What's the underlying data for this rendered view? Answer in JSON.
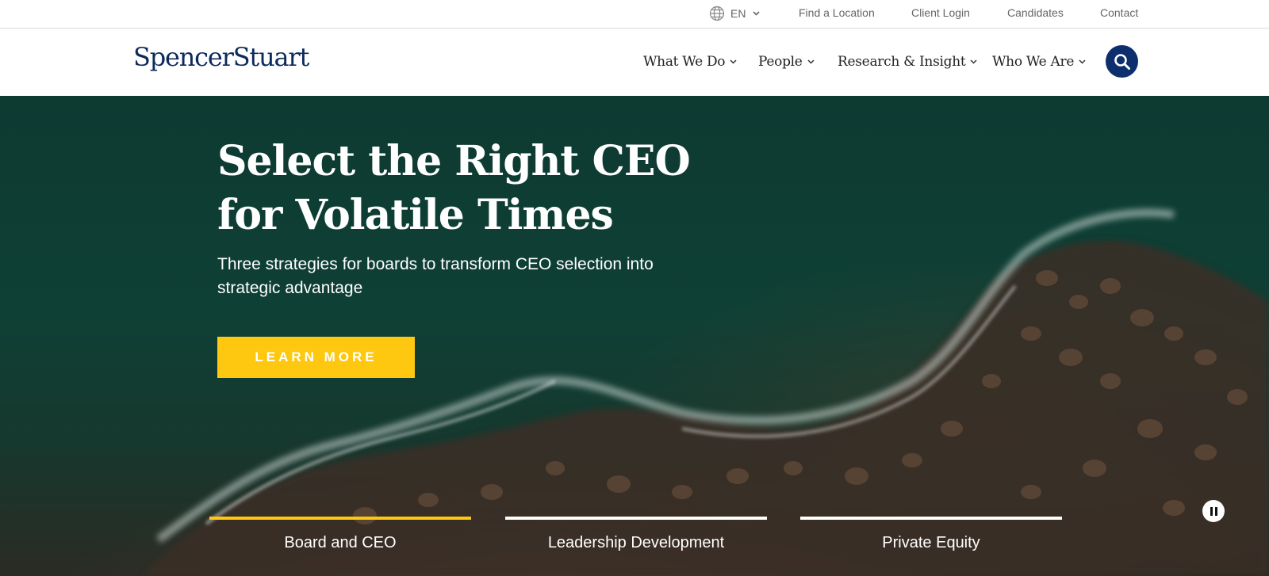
{
  "utility_bar": {
    "language": "EN",
    "links": [
      "Find a Location",
      "Client Login",
      "Candidates",
      "Contact"
    ]
  },
  "header": {
    "logo": "SpencerStuart",
    "nav": [
      "What We Do",
      "People",
      "Research & Insight",
      "Who We Are"
    ]
  },
  "hero": {
    "title": "Select the Right CEO for Volatile Times",
    "subtitle": "Three strategies for boards to transform CEO selection into strategic advantage",
    "cta": "LEARN MORE"
  },
  "tabs": [
    "Board and CEO",
    "Leadership Development",
    "Private Equity"
  ],
  "colors": {
    "brand_navy": "#0e2a5c",
    "accent_yellow": "#fdc80f",
    "search_blue": "#0e2f6e"
  },
  "icons": [
    "globe-icon",
    "chevron-down-icon",
    "search-icon",
    "pause-icon"
  ]
}
